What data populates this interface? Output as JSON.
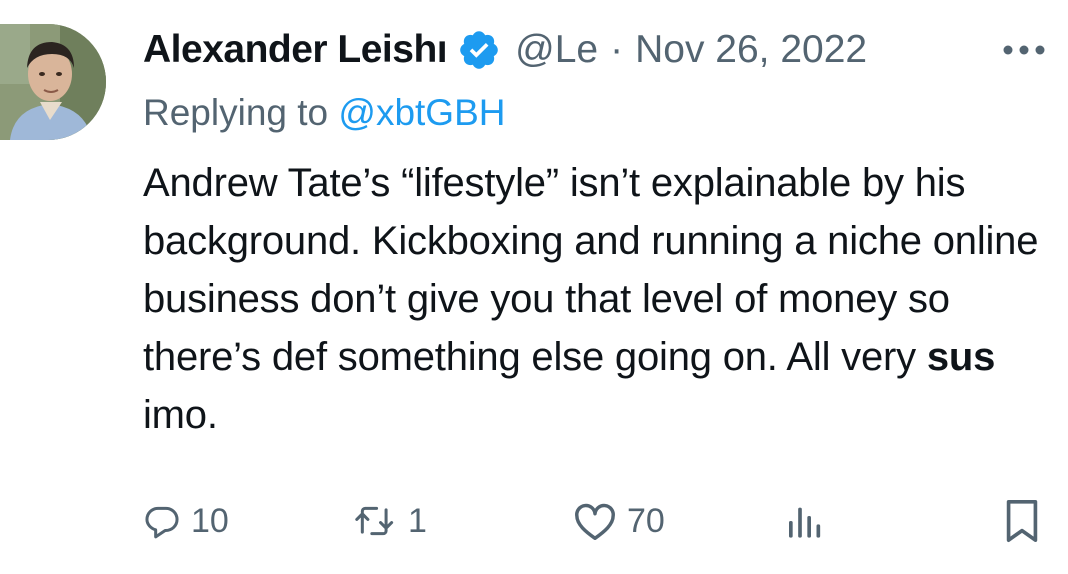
{
  "author": {
    "name": "Alexander Leishı",
    "handle": "@Le",
    "separator": "·",
    "date": "Nov 26, 2022",
    "verified": true
  },
  "reply": {
    "prefix": "Replying to ",
    "mention": "@xbtGBH"
  },
  "tweet": {
    "text_before_bold": "Andrew Tate’s “lifestyle” isn’t explainable by his background. Kickboxing and running a niche online business don’t give you that level of money so there’s def something else going on. All very ",
    "bold_text": "sus",
    "text_after_bold": " imo."
  },
  "actions": {
    "replies": "10",
    "retweets": "1",
    "likes": "70"
  },
  "icons": {
    "verified": "verified-badge-icon",
    "more": "more-options-icon",
    "reply": "reply-icon",
    "retweet": "retweet-icon",
    "like": "heart-icon",
    "views": "views-chart-icon",
    "bookmark": "bookmark-icon"
  },
  "colors": {
    "text": "#0f1419",
    "secondary": "#536471",
    "accent": "#1d9bf0"
  }
}
